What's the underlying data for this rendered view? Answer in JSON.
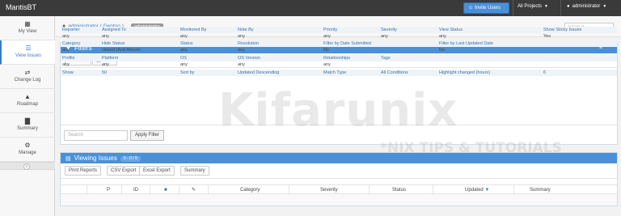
{
  "navbar": {
    "brand": "MantisBT",
    "invite_label": "Invite Users",
    "projects_label": "All Projects",
    "user_label": "administrator"
  },
  "sidebar": {
    "items": [
      {
        "label": "My View",
        "icon": "dashboard-icon"
      },
      {
        "label": "View Issues",
        "icon": "list-icon"
      },
      {
        "label": "Change Log",
        "icon": "retweet-icon"
      },
      {
        "label": "Roadmap",
        "icon": "road-icon"
      },
      {
        "label": "Summary",
        "icon": "bar-chart-icon"
      },
      {
        "label": "Manage",
        "icon": "gears-icon"
      }
    ],
    "collapse_glyph": "«"
  },
  "breadcrumb": {
    "user": "administrator ( Gentoo )",
    "badge": "administrator",
    "search_placeholder": "Issue #"
  },
  "filters": {
    "title": "Filters",
    "reset_label": "Reset",
    "save_label": "Save",
    "rows": [
      {
        "type": "lbl",
        "cells": [
          "Reporter",
          "Assigned To",
          "Monitored By",
          "Note By",
          "Priority",
          "Severity",
          "View Status",
          "Show Sticky Issues"
        ]
      },
      {
        "type": "val",
        "cells": [
          "any",
          "any",
          "any",
          "any",
          "any",
          "any",
          "any",
          "Yes"
        ]
      },
      {
        "type": "lbl",
        "cells": [
          "Category",
          "Hide Status",
          "Status",
          "Resolution",
          "Filter by Date Submitted",
          "",
          "Filter by Last Updated Date",
          ""
        ]
      },
      {
        "type": "val",
        "cells": [
          "any",
          "closed (And Above)",
          "any",
          "any",
          "No",
          "",
          "No",
          ""
        ]
      },
      {
        "type": "lbl",
        "cells": [
          "Profile",
          "Platform",
          "OS",
          "OS Version",
          "Relationships",
          "Tags",
          "",
          ""
        ]
      },
      {
        "type": "val",
        "cells": [
          "any",
          "any",
          "any",
          "any",
          "any",
          "",
          "",
          ""
        ]
      },
      {
        "type": "lbl",
        "cells": [
          "Show",
          "50",
          "Sort by",
          "Updated Descending",
          "Match Type",
          "All Conditions",
          "Highlight changed (hours)",
          "6"
        ]
      }
    ],
    "search_placeholder": "Search",
    "apply_label": "Apply Filter"
  },
  "issues": {
    "title": "Viewing Issues",
    "count_badge": "0 - 0 / 0",
    "buttons": [
      "Print Reports",
      "CSV Export",
      "Excel Export",
      "Summary"
    ],
    "columns": [
      "",
      "P",
      "ID",
      "",
      "",
      "Category",
      "Severity",
      "Status",
      "Updated",
      "Summary"
    ]
  },
  "watermark": {
    "main": "Kifarunix",
    "sub": "*NIX TIPS & TUTORIALS"
  },
  "colors": {
    "accent": "#4a90d9",
    "navbar": "#3a3a3a",
    "sidebar_active": "#3a7cc1"
  }
}
